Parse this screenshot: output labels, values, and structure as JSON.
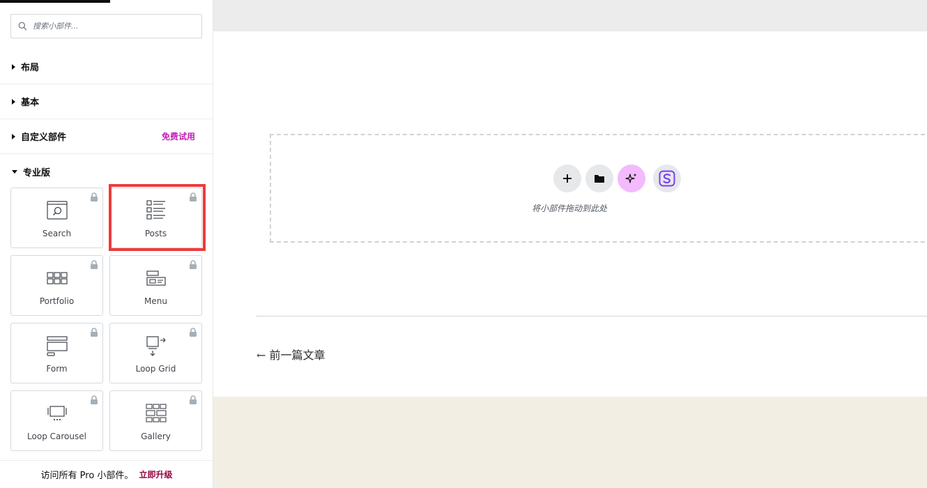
{
  "search": {
    "placeholder": "搜索小部件..."
  },
  "categories": [
    {
      "label": "布局"
    },
    {
      "label": "基本"
    },
    {
      "label": "自定义部件",
      "promo": "免费试用"
    },
    {
      "label": "专业版"
    }
  ],
  "widgets": [
    {
      "label": "Search",
      "icon": "search-widget-icon"
    },
    {
      "label": "Posts",
      "icon": "posts-icon"
    },
    {
      "label": "Portfolio",
      "icon": "portfolio-icon"
    },
    {
      "label": "Menu",
      "icon": "menu-icon"
    },
    {
      "label": "Form",
      "icon": "form-icon"
    },
    {
      "label": "Loop Grid",
      "icon": "loop-grid-icon"
    },
    {
      "label": "Loop Carousel",
      "icon": "loop-carousel-icon"
    },
    {
      "label": "Gallery",
      "icon": "gallery-icon"
    }
  ],
  "footer": {
    "text": "访问所有 Pro 小部件。",
    "upgrade": "立即升级"
  },
  "dropzone": {
    "text": "将小部件拖动到此处"
  },
  "post_nav": {
    "previous": "← 前一篇文章"
  },
  "colors": {
    "promo": "#c21fb6",
    "upgrade": "#93003f",
    "highlight": "#ee3b3b",
    "ai": "#f3bafd",
    "brand_s": "#7b3ff2"
  }
}
